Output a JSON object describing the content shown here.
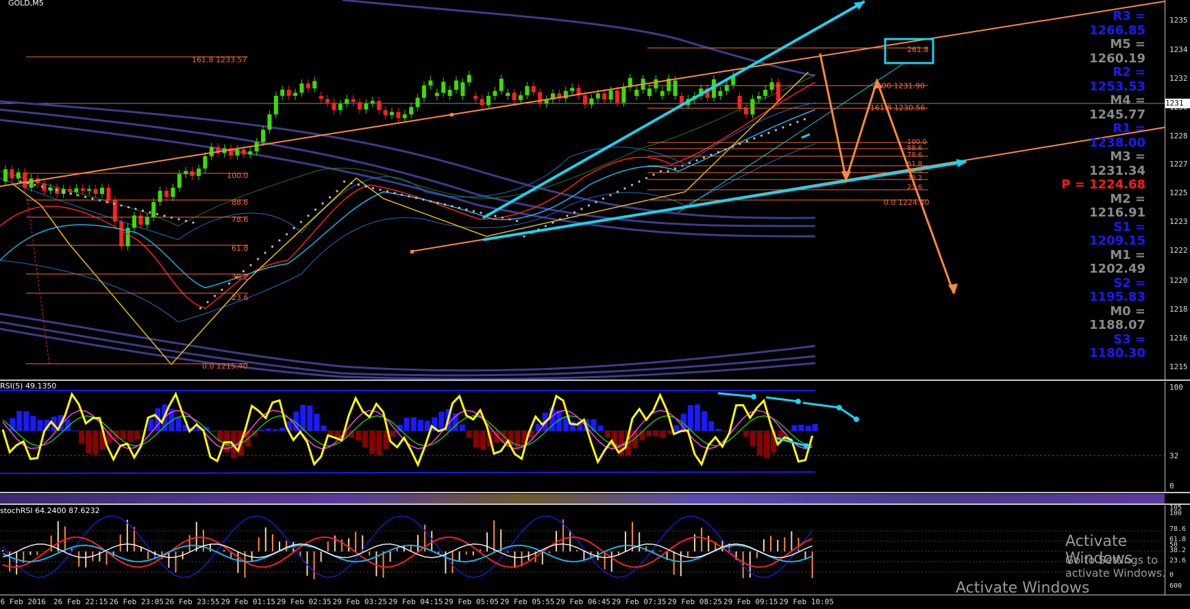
{
  "chart_title": "GOLD,M5",
  "main_axis_ticks": [
    "1235",
    "1234",
    "1232",
    "1230",
    "1228",
    "1227",
    "1225",
    "1223",
    "1222",
    "1220",
    "1218",
    "1216",
    "1215"
  ],
  "current_price_tag": "1231",
  "pivots": [
    {
      "label": "R3 = 1266.85",
      "color": "#1a1aff"
    },
    {
      "label": "M5 = 1260.19",
      "color": "#8a8a8a"
    },
    {
      "label": "R2 = 1253.53",
      "color": "#1a1aff"
    },
    {
      "label": "M4 = 1245.77",
      "color": "#8a8a8a"
    },
    {
      "label": "R1 = 1238.00",
      "color": "#1a1aff"
    },
    {
      "label": "M3 = 1231.34",
      "color": "#8a8a8a"
    },
    {
      "label": "P   = 1224.68",
      "color": "#ff1a1a"
    },
    {
      "label": "M2 = 1216.91",
      "color": "#8a8a8a"
    },
    {
      "label": "S1 = 1209.15",
      "color": "#1a1aff"
    },
    {
      "label": "M1 = 1202.49",
      "color": "#8a8a8a"
    },
    {
      "label": "S2 = 1195.83",
      "color": "#1a1aff"
    },
    {
      "label": "M0 = 1188.07",
      "color": "#8a8a8a"
    },
    {
      "label": "S3 = 1180.30",
      "color": "#1a1aff"
    }
  ],
  "fib_left": [
    "161.8 1233.57",
    "100.0",
    "88.6",
    "78.6",
    "61.8",
    "38.2",
    "23.6",
    "0.0 1215.40"
  ],
  "fib_right": [
    "261.8",
    "100 1231.90",
    "161.8 1230.56",
    "100.0",
    "88.6",
    "78.6",
    "61.8",
    "50.0",
    "38.2",
    "23.6",
    "0.0 1224.40"
  ],
  "rsi_label": "RSI(5) 49.1350",
  "rsi_axis": [
    "100",
    "32",
    "0"
  ],
  "stoch_label": "stochRSI 64.2400 87.6232",
  "stoch_axis": [
    "105",
    "100",
    "78.6",
    "61.8",
    "50",
    "38.2",
    "23.6",
    "0",
    "600"
  ],
  "time_labels": [
    "26 Feb 2016",
    "26 Feb 22:15",
    "26 Feb 23:05",
    "26 Feb 23:55",
    "29 Feb 01:15",
    "29 Feb 02:35",
    "29 Feb 03:25",
    "29 Feb 04:15",
    "29 Feb 05:05",
    "29 Feb 05:55",
    "29 Feb 06:45",
    "29 Feb 07:35",
    "29 Feb 08:25",
    "29 Feb 09:15",
    "29 Feb 10:05"
  ],
  "watermark": {
    "line1": "Activate Windows",
    "line2": "Go to Settings to activate Windows.",
    "line3": "Activate Windows"
  },
  "colors": {
    "up": "#3cdc00",
    "down": "#ff2020",
    "cyan": "#19d3f0",
    "orange": "#ff8a3c",
    "fib": "#ff6a2a",
    "band": "#3c3c8c",
    "histo_up": "#1a1aff",
    "histo_down": "#8b0000",
    "rsi": "#ffff00"
  }
}
